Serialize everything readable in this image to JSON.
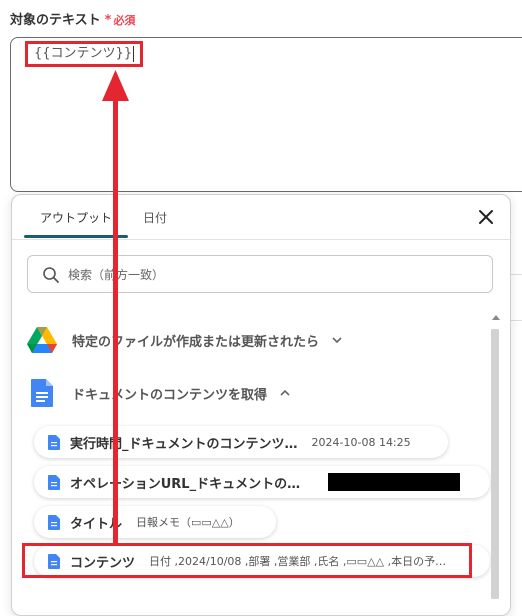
{
  "field": {
    "label": "対象のテキスト",
    "required_mark": "*",
    "required_text": "必須",
    "token": "{{コンテンツ}}"
  },
  "popup": {
    "tabs": [
      {
        "label": "アウトプット",
        "active": true
      },
      {
        "label": "日付",
        "active": false
      }
    ],
    "close_icon": "close-icon",
    "search": {
      "placeholder": "検索（前方一致）"
    },
    "sections": [
      {
        "icon": "google-drive-icon",
        "title": "特定のファイルが作成または更新されたら",
        "expanded": false
      },
      {
        "icon": "google-docs-icon",
        "title": "ドキュメントのコンテンツを取得",
        "expanded": true
      }
    ],
    "items": [
      {
        "name": "実行時間_ドキュメントのコンテンツ…",
        "value": "2024-10-08 14:25"
      },
      {
        "name": "オペレーションURL_ドキュメントの…",
        "value": ""
      },
      {
        "name": "タイトル",
        "value": "日報メモ（▭▭△△）"
      },
      {
        "name": "コンテンツ",
        "value": "日付 ,2024/10/08 ,部署 ,営業部 ,氏名 ,▭▭△△ ,本日の予…"
      }
    ]
  },
  "colors": {
    "accent_tab": "#1a5e75",
    "annotation_red": "#e3262f",
    "required_red": "#e84855"
  }
}
